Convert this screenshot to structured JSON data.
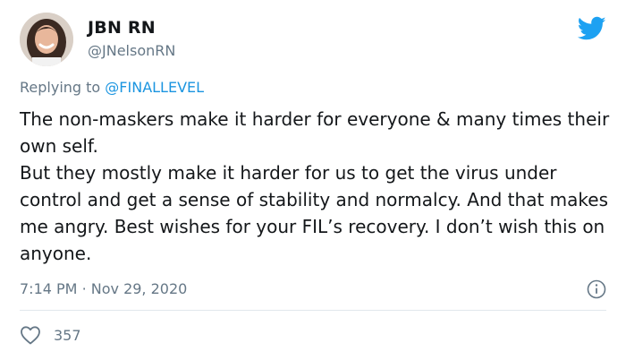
{
  "author": {
    "display_name": "JBN RN",
    "handle": "@JNelsonRN",
    "avatar_icon": "profile-photo"
  },
  "reply": {
    "prefix": "Replying to",
    "mention": "@FINALLEVEL"
  },
  "tweet": {
    "paragraph_1": "The non-maskers make it harder for everyone & many times their own self.",
    "paragraph_2": "But they mostly make it harder for us to get the virus under control and get a sense of stability and normalcy. And that makes me angry. Best wishes for your FIL’s recovery. I don’t wish this on anyone."
  },
  "meta": {
    "time": "7:14 PM",
    "separator": "·",
    "date": "Nov 29, 2020"
  },
  "stats": {
    "likes": "357"
  },
  "icons": {
    "brand": "twitter-bird-icon",
    "info": "info-icon",
    "like": "heart-icon"
  },
  "colors": {
    "brand": "#1DA1F2",
    "mention": "#1B95E0",
    "secondary_text": "#657786",
    "divider": "#E1E8ED"
  }
}
